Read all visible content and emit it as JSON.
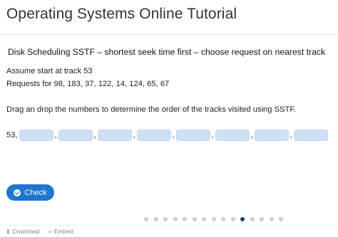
{
  "header": {
    "title": "Operating Systems Online Tutorial"
  },
  "task": {
    "title": "Disk Scheduling SSTF – shortest seek time first – choose request on nearest track",
    "start_line": "Assume start at track 53",
    "requests_line": "Requests for 98, 183, 37, 122, 14, 124, 65, 67",
    "instruction": "Drag an drop the numbers to determine the order of the tracks visited using SSTF.",
    "answer_prefix": "53,",
    "slot_count": 8,
    "slot_separator": ","
  },
  "actions": {
    "check_label": "Check",
    "check_icon": "check-circle-icon"
  },
  "pager": {
    "total": 15,
    "current": 11
  },
  "footer": {
    "download_icon": "download-icon",
    "download_label": "Download",
    "embed_icon": "code-icon",
    "embed_label": "Embed"
  },
  "colors": {
    "accent": "#1f75cf",
    "slot_fill": "#cfe0f5",
    "pager_active": "#1b3f6a",
    "pager_inactive": "#cfcfcf"
  }
}
